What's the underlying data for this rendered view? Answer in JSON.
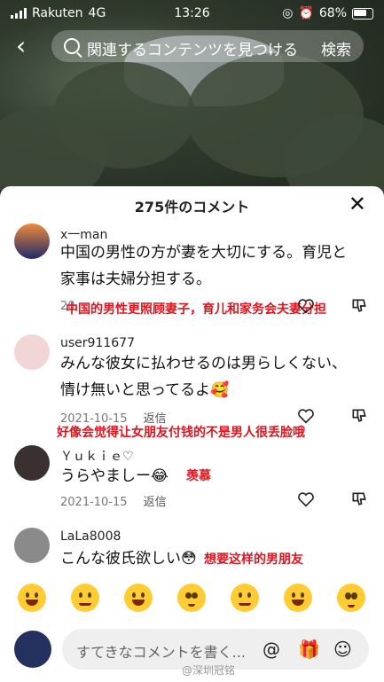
{
  "status": {
    "carrier": "Rakuten",
    "network": "4G",
    "time": "13:26",
    "battery": "68%"
  },
  "topbar": {
    "back_icon": "chevron-left-icon",
    "search_placeholder": "関連するコンテンツを見つける",
    "search_button": "検索"
  },
  "sheet": {
    "title": "275件のコメント",
    "close_icon": "close-icon"
  },
  "comments": [
    {
      "user": "x一man",
      "lines": [
        "中国の男性の方が妻を大切にする。育児と",
        "家事は夫婦分担する。"
      ],
      "date": "20",
      "annotation": "中国的男性更照顾妻子，育儿和家务会夫妻分担",
      "avatar_color": "#1f2a6b"
    },
    {
      "user": "user911677",
      "lines": [
        "みんな彼女に払わせるのは男らしくない、",
        "情け無いと思ってるよ🥰"
      ],
      "date": "2021-10-15",
      "reply": "返信",
      "annotation": "好像会觉得让女朋友付钱的不是男人很丢脸哦",
      "avatar_color": "#f2d6d6"
    },
    {
      "user": "Ｙｕｋｉｅ♡",
      "lines": [
        "うらやましー😂"
      ],
      "date": "2021-10-15",
      "reply": "返信",
      "annotation": "羡慕",
      "avatar_color": "#3a3030"
    },
    {
      "user": "LaLa8008",
      "lines": [
        "こんな彼氏欲しい😳"
      ],
      "annotation": "想要这样的男朋友",
      "avatar_color": "#8a8a8a"
    }
  ],
  "emojis": [
    "grinning",
    "smiling-hearts",
    "joy",
    "flushed",
    "smirk",
    "sweat-smile",
    "pleading"
  ],
  "input": {
    "placeholder": "すてきなコメントを書く...",
    "at_icon": "@",
    "gift_icon": "gift-icon",
    "emoji_icon": "emoji-icon"
  },
  "watermark": "@深圳冠铭"
}
